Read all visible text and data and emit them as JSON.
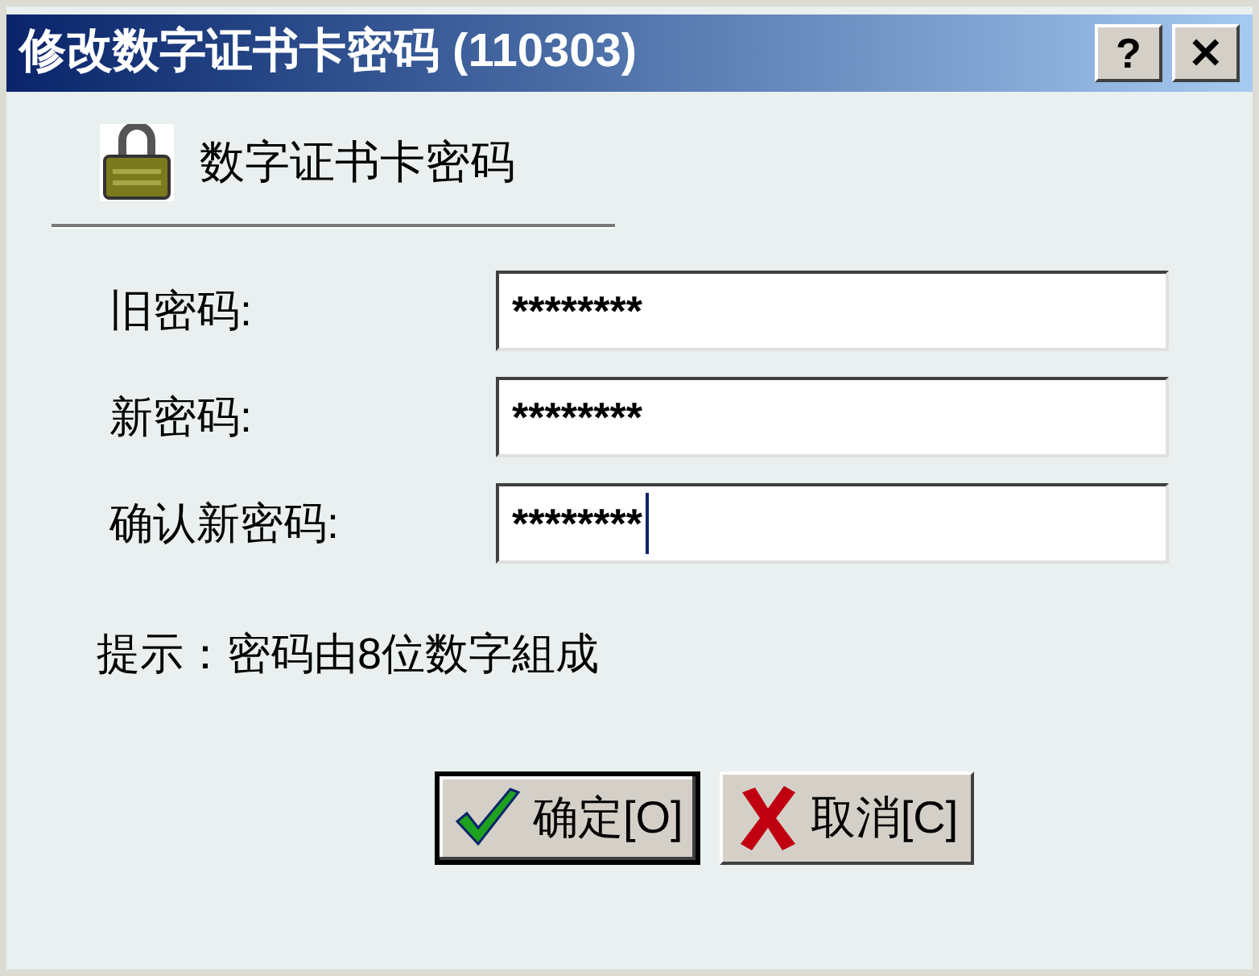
{
  "window": {
    "title": "修改数字证书卡密码 (110303)",
    "title_buttons": [
      "?",
      "✕"
    ]
  },
  "header": {
    "title": "数字证书卡密码"
  },
  "fields": [
    {
      "label": "旧密码:",
      "value": "********",
      "focused": false
    },
    {
      "label": "新密码:",
      "value": "********",
      "focused": false
    },
    {
      "label": "确认新密码:",
      "value": "********",
      "focused": true
    }
  ],
  "hint": "提示：密码由8位数字組成",
  "buttons": [
    {
      "kind": "ok",
      "label": "确定[O]",
      "default": true
    },
    {
      "kind": "cancel",
      "label": "取消[C]",
      "default": false
    }
  ]
}
